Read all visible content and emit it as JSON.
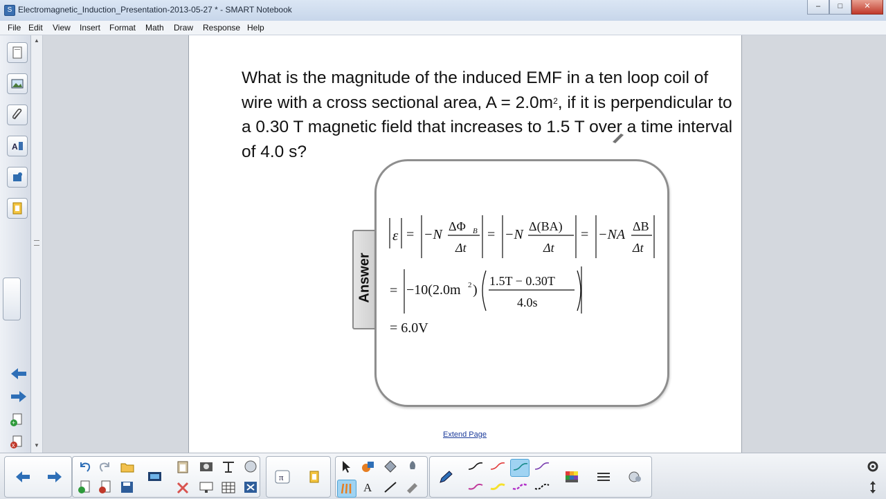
{
  "window": {
    "title": "Electromagnetic_Induction_Presentation-2013-05-27 * - SMART Notebook",
    "minimize": "–",
    "maximize": "□",
    "close": "✕"
  },
  "menu": [
    "File",
    "Edit",
    "View",
    "Insert",
    "Format",
    "Math",
    "Draw",
    "Response",
    "Help"
  ],
  "sidebar_tabs": [
    "page-sorter-icon",
    "gallery-icon",
    "attachments-icon",
    "properties-icon",
    "addons-icon",
    "lesson-activity-icon"
  ],
  "question": {
    "part1": "What is the magnitude of the induced EMF in a ten loop coil of wire with a cross sectional area, A = 2.0m",
    "sup": "2",
    "part2": ", if it is perpendicular to a 0.30 T magnetic field that increases to 1.5 T over a time interval of 4.0 s?"
  },
  "answer_tab_label": "Answer",
  "solution": {
    "line1": {
      "abs_emf": "ε",
      "eq": "=",
      "neg_n": "−N",
      "dphi": "ΔΦ",
      "phi_sub": "B",
      "dt": "Δt",
      "dba": "Δ(BA)",
      "neg_na": "−NA",
      "db": "ΔB"
    },
    "line2": {
      "lead": "−10(2.0m",
      "sq": "2",
      "close": ")",
      "num": "1.5T − 0.30T",
      "den": "4.0s"
    },
    "line3": "= 6.0V"
  },
  "extend_page": "Extend Page",
  "toolbar": {
    "groups": [
      [
        "previous-page-icon",
        "next-page-icon"
      ],
      [
        "undo-icon",
        "redo-icon",
        "open-file-icon",
        "add-page-icon",
        "delete-page-icon",
        "save-icon"
      ],
      [
        "screen-shade-icon",
        "paste-icon",
        "delete-icon",
        "capture-icon",
        "display-screen-icon",
        "table-icon",
        "fullscreen-icon",
        "insert-icon",
        "clear-icon"
      ],
      [
        "math-icon",
        "response-icon"
      ],
      [
        "select-icon",
        "shapes-icon",
        "fill-icon",
        "eraser-icon",
        "creative-pen-icon",
        "text-icon",
        "line-icon",
        "magic-pen-icon"
      ],
      [
        "pen-icon",
        "pen-black",
        "pen-red",
        "pen-teal",
        "pen-purple",
        "pen-magenta",
        "pen-yellow",
        "pen-violet",
        "pen-black-dashed",
        "color-palette-icon",
        "line-style-icon",
        "properties-icon"
      ]
    ]
  },
  "colors": {
    "accent": "#4fa3d6",
    "link": "#1a3a9a"
  }
}
